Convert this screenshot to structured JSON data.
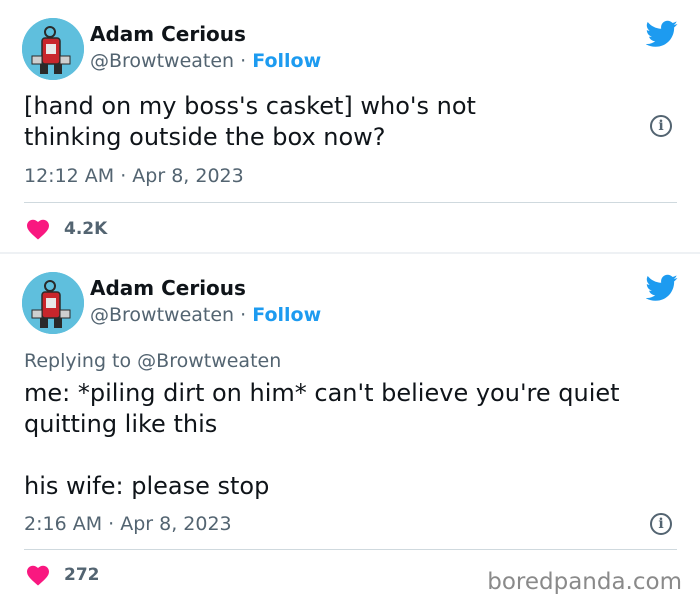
{
  "tweets": [
    {
      "author": "Adam Cerious",
      "handle": "@Browtweaten",
      "separator": " · ",
      "follow_label": "Follow",
      "replying_to": "",
      "text": "[hand on my boss's casket] who's not\nthinking outside the box now?",
      "timestamp": "12:12 AM · Apr 8, 2023",
      "likes": "4.2K"
    },
    {
      "author": "Adam Cerious",
      "handle": "@Browtweaten",
      "separator": " · ",
      "follow_label": "Follow",
      "replying_to": "Replying to @Browtweaten",
      "text": "me: *piling dirt on him* can't believe you're quiet\nquitting like this\n\nhis wife: please stop",
      "timestamp": "2:16 AM · Apr 8, 2023",
      "likes": "272"
    }
  ],
  "icons": {
    "bird": "twitter-bird-icon",
    "info": "info-icon",
    "heart": "heart-icon"
  },
  "colors": {
    "brand_blue": "#1d9bf0",
    "heart_pink": "#f91880",
    "avatar_bg": "#5fbfdd",
    "secondary_text": "#536471"
  },
  "watermark": "boredpanda.com"
}
